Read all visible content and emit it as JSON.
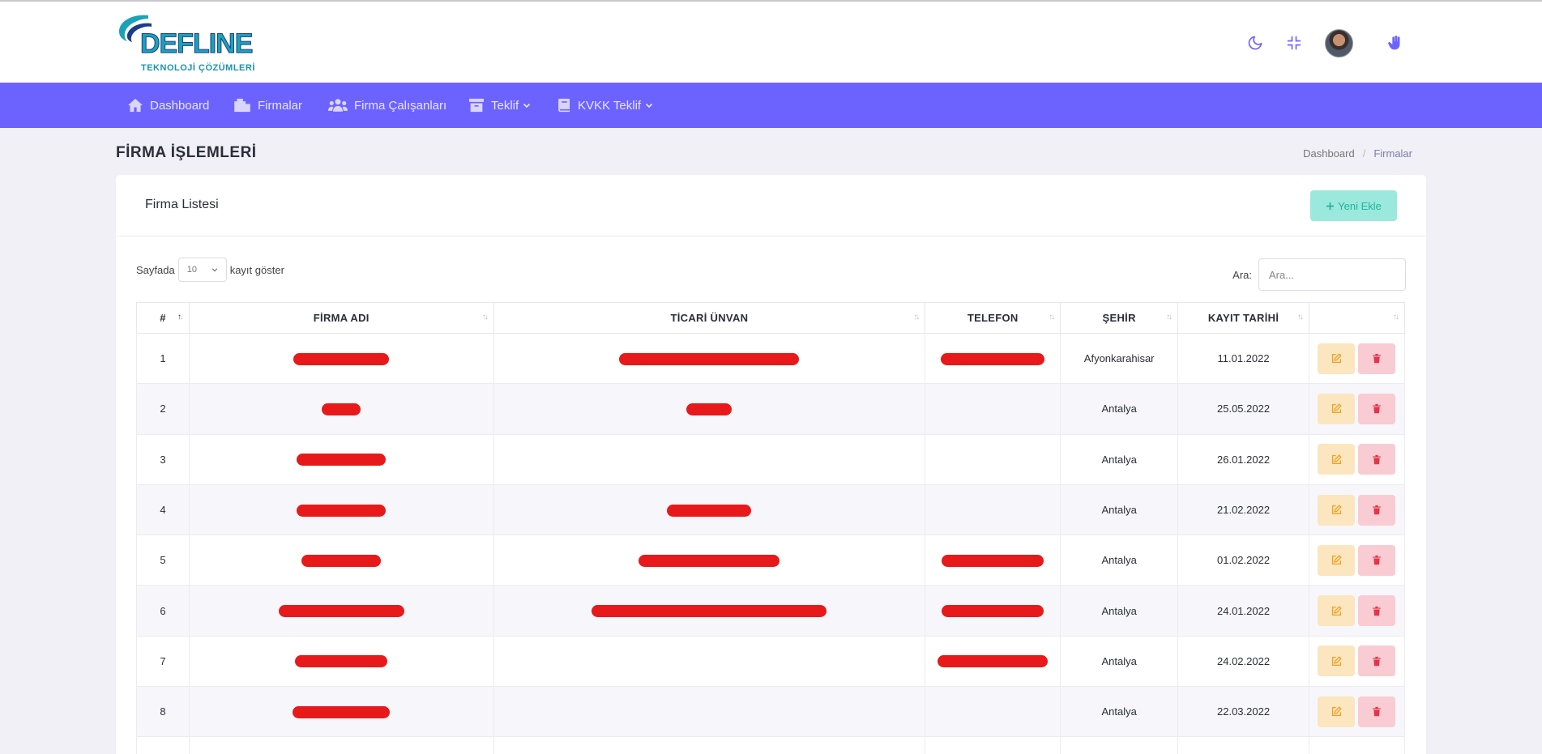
{
  "brand": {
    "word": "DEFLINE",
    "tagline": "TEKNOLOJİ ÇÖZÜMLERİ",
    "accent": "#6c63ff"
  },
  "header_icons": [
    "moon-icon",
    "compress-icon",
    "avatar",
    "hand-icon"
  ],
  "nav": [
    {
      "label": "Dashboard",
      "icon": "home-icon"
    },
    {
      "label": "Firmalar",
      "icon": "building-icon"
    },
    {
      "label": "Firma Çalışanları",
      "icon": "users-icon"
    },
    {
      "label": "Teklif",
      "icon": "archive-icon",
      "dropdown": true
    },
    {
      "label": "KVKK Teklif",
      "icon": "book-icon",
      "dropdown": true
    }
  ],
  "page": {
    "title": "FİRMA İŞLEMLERİ"
  },
  "breadcrumb": {
    "home": "Dashboard",
    "sep": "/",
    "current": "Firmalar"
  },
  "card": {
    "title": "Firma Listesi",
    "add_label": "Yeni Ekle"
  },
  "length": {
    "before": "Sayfada",
    "value": "10",
    "after": "kayıt göster"
  },
  "search": {
    "label": "Ara:",
    "placeholder": "Ara..."
  },
  "columns": [
    "#",
    "FİRMA ADI",
    "TİCARİ ÜNVAN",
    "TELEFON",
    "ŞEHİR",
    "KAYIT TARİHİ",
    ""
  ],
  "rows": [
    {
      "no": "1",
      "city": "Afyonkarahisar",
      "date": "11.01.2022",
      "name_redacted": true,
      "title_redacted": true,
      "phone_redacted": true
    },
    {
      "no": "2",
      "city": "Antalya",
      "date": "25.05.2022",
      "name_redacted": true,
      "title_redacted": true,
      "phone_redacted": false
    },
    {
      "no": "3",
      "city": "Antalya",
      "date": "26.01.2022",
      "name_redacted": true,
      "title_redacted": false,
      "phone_redacted": false
    },
    {
      "no": "4",
      "city": "Antalya",
      "date": "21.02.2022",
      "name_redacted": true,
      "title_redacted": true,
      "phone_redacted": false
    },
    {
      "no": "5",
      "city": "Antalya",
      "date": "01.02.2022",
      "name_redacted": true,
      "title_redacted": true,
      "phone_redacted": true
    },
    {
      "no": "6",
      "city": "Antalya",
      "date": "24.01.2022",
      "name_redacted": true,
      "title_redacted": true,
      "phone_redacted": true
    },
    {
      "no": "7",
      "city": "Antalya",
      "date": "24.02.2022",
      "name_redacted": true,
      "title_redacted": false,
      "phone_redacted": true
    },
    {
      "no": "8",
      "city": "Antalya",
      "date": "22.03.2022",
      "name_redacted": true,
      "title_redacted": false,
      "phone_redacted": false
    },
    {
      "no": "",
      "city": "",
      "date": "",
      "name_redacted": false,
      "title_redacted": false,
      "phone_redacted": false
    }
  ]
}
